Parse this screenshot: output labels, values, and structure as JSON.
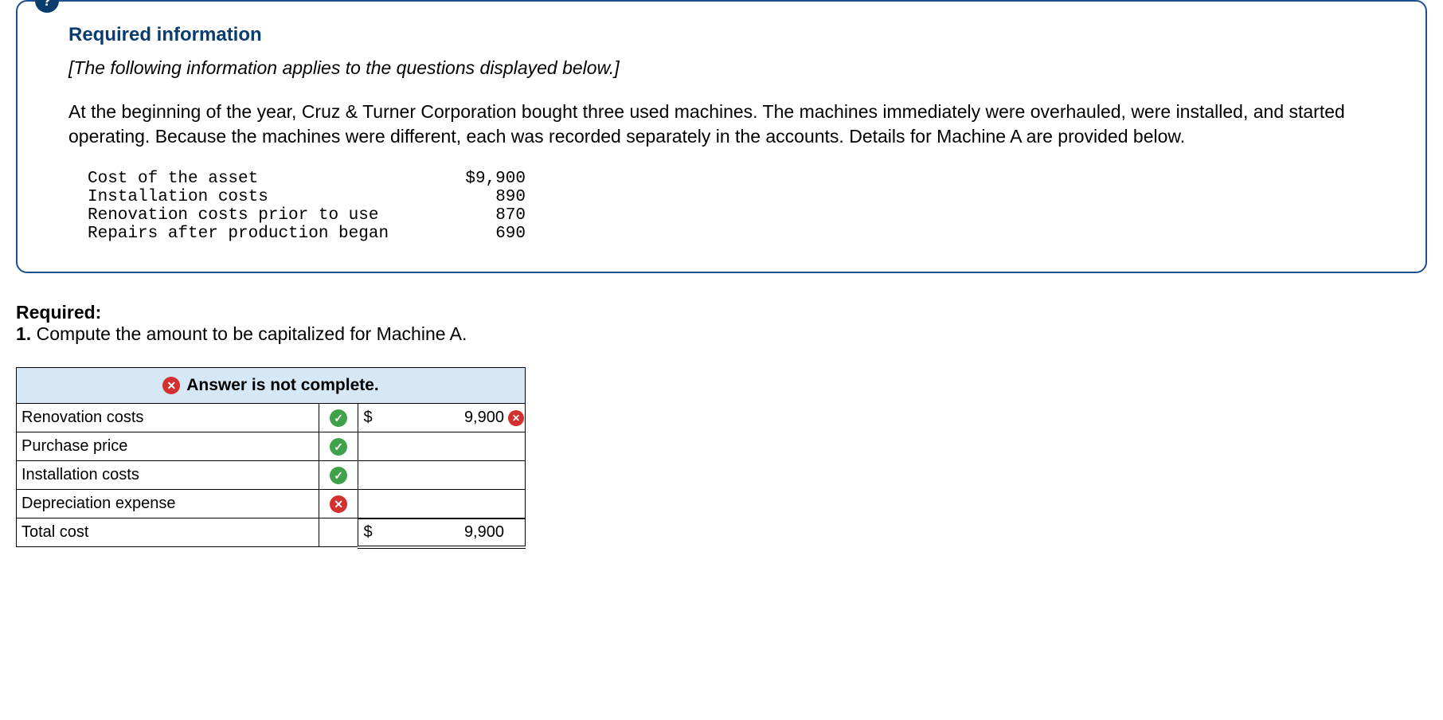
{
  "qmark": "?",
  "info": {
    "title": "Required information",
    "applies": "[The following information applies to the questions displayed below.]",
    "paragraph": "At the beginning of the year, Cruz & Turner Corporation bought three used machines. The machines immediately were overhauled, were installed, and started operating. Because the machines were different, each was recorded separately in the accounts. Details for Machine A are provided below.",
    "rows": [
      {
        "label": "Cost of the asset",
        "value": "$9,900"
      },
      {
        "label": "Installation costs",
        "value": "890"
      },
      {
        "label": "Renovation costs prior to use",
        "value": "870"
      },
      {
        "label": "Repairs after production began",
        "value": "690"
      }
    ]
  },
  "required": {
    "heading": "Required:",
    "num": "1.",
    "text": " Compute the amount to be capitalized for Machine A."
  },
  "banner": {
    "icon": "x",
    "text": "Answer is not complete."
  },
  "icons": {
    "check": "✓",
    "x": "✕"
  },
  "table": {
    "rows": [
      {
        "label": "Renovation costs",
        "mark": "check",
        "dollar": "$",
        "amount": "9,900",
        "amount_mark": "x"
      },
      {
        "label": "Purchase price",
        "mark": "check",
        "dollar": "",
        "amount": "",
        "amount_mark": ""
      },
      {
        "label": "Installation costs",
        "mark": "check",
        "dollar": "",
        "amount": "",
        "amount_mark": ""
      },
      {
        "label": "Depreciation expense",
        "mark": "x",
        "dollar": "",
        "amount": "",
        "amount_mark": ""
      }
    ],
    "total": {
      "label": "Total cost",
      "dollar": "$",
      "amount": "9,900"
    }
  }
}
